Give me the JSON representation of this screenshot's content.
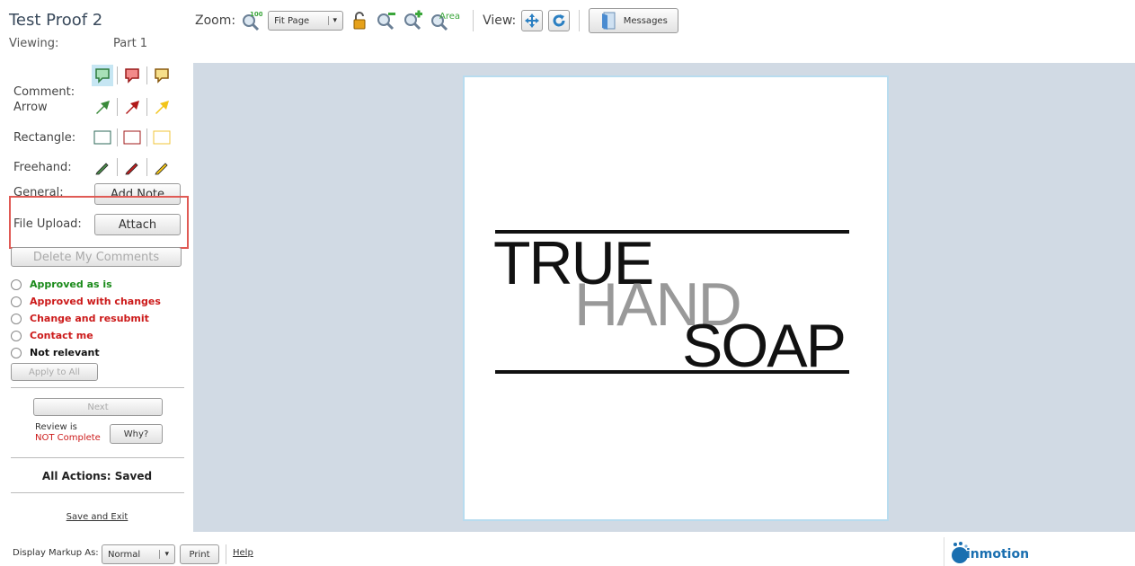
{
  "header": {
    "title": "Test Proof 2",
    "viewing_label": "Viewing:",
    "viewing_value": "Part 1"
  },
  "toolbar": {
    "zoom_label": "Zoom:",
    "zoom_select": "Fit Page",
    "zoom_100_label": "100%",
    "zoom_area_label": "Area",
    "view_label": "View:",
    "messages_label": "Messages"
  },
  "sidebar": {
    "comment_label": "Comment:",
    "arrow_label": "Arrow",
    "rectangle_label": "Rectangle:",
    "freehand_label": "Freehand:",
    "general_label": "General:",
    "add_note_label": "Add Note",
    "file_upload_label": "File Upload:",
    "attach_label": "Attach",
    "delete_comments_label": "Delete My Comments",
    "statuses": [
      {
        "label": "Approved as is",
        "color": "green"
      },
      {
        "label": "Approved with changes",
        "color": "red"
      },
      {
        "label": "Change and resubmit",
        "color": "red"
      },
      {
        "label": "Contact me",
        "color": "red"
      },
      {
        "label": "Not relevant",
        "color": "black"
      }
    ],
    "apply_all_label": "Apply to All",
    "next_label": "Next",
    "review_is": "Review is",
    "review_status": "NOT Complete",
    "why_label": "Why?",
    "actions_text": "All Actions:  Saved",
    "save_exit_label": "Save and Exit"
  },
  "canvas": {
    "logo_word_1": "TRUE",
    "logo_word_2": "HAND",
    "logo_word_3": "SOAP"
  },
  "footer": {
    "display_label": "Display Markup As:",
    "display_value": "Normal",
    "print_label": "Print",
    "help_label": "Help",
    "brand_text": "inmotion"
  },
  "colors": {
    "annotation_red": "#e05a55",
    "viewer_bg": "#d1dae4",
    "accent_blue": "#2a7fc2"
  }
}
